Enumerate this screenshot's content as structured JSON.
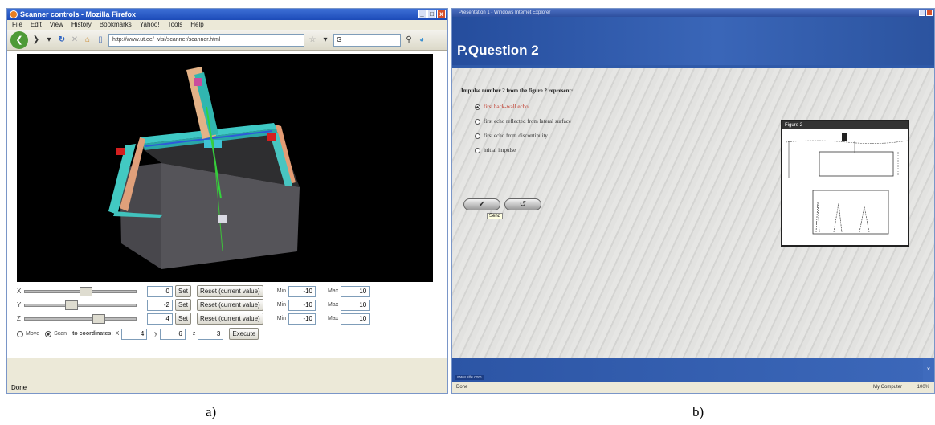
{
  "left_window": {
    "title": "Scanner controls - Mozilla Firefox",
    "window_buttons": [
      "_",
      "□",
      "x"
    ],
    "menu": [
      "File",
      "Edit",
      "View",
      "History",
      "Bookmarks",
      "Yahoo!",
      "Tools",
      "Help"
    ],
    "url": "http://www.ut.ee/~vlsi/scanner/scanner.html",
    "search_value": "G",
    "status": "Done",
    "axes": [
      {
        "label": "X",
        "value": 0,
        "set_label": "Set",
        "reset_label": "Reset (current value)",
        "min_label": "Min",
        "min": -10,
        "max_label": "Max",
        "max": 10,
        "slider_fraction": 0.55
      },
      {
        "label": "Y",
        "value": -2,
        "set_label": "Set",
        "reset_label": "Reset (current value)",
        "min_label": "Min",
        "min": -10,
        "max_label": "Max",
        "max": 10,
        "slider_fraction": 0.4
      },
      {
        "label": "Z",
        "value": 4,
        "set_label": "Set",
        "reset_label": "Reset (current value)",
        "min_label": "Min",
        "min": -10,
        "max_label": "Max",
        "max": 10,
        "slider_fraction": 0.68
      }
    ],
    "mode": {
      "move_label": "Move",
      "scan_label": "Scan",
      "selected": "Scan",
      "to_label": "to coordinates:"
    },
    "coords": {
      "x_label": "X",
      "x": 4,
      "y_label": "y",
      "y": 6,
      "z_label": "z",
      "z": 3
    },
    "execute_label": "Execute"
  },
  "right_window": {
    "title": "Presentation 1 - Windows Internet Explorer",
    "heading": "P.Question 2",
    "question": "Impulse number 2 from the figure 2 represent:",
    "options": [
      {
        "label": "first back-wall echo",
        "selected": true
      },
      {
        "label": "first echo reflected from lateral surface",
        "selected": false
      },
      {
        "label": "first echo from discontinuity",
        "selected": false
      },
      {
        "label": "initial impulse",
        "selected": false
      }
    ],
    "submit_glyph": "✔",
    "clear_glyph": "↺",
    "tooltip": "Send",
    "figure_title": "Figure 2",
    "footer_link": "www.site.com",
    "close_glyph": "×",
    "status": "Done",
    "zone": "My Computer",
    "zoom": "100%"
  },
  "captions": {
    "a": "a)",
    "b": "b)"
  }
}
